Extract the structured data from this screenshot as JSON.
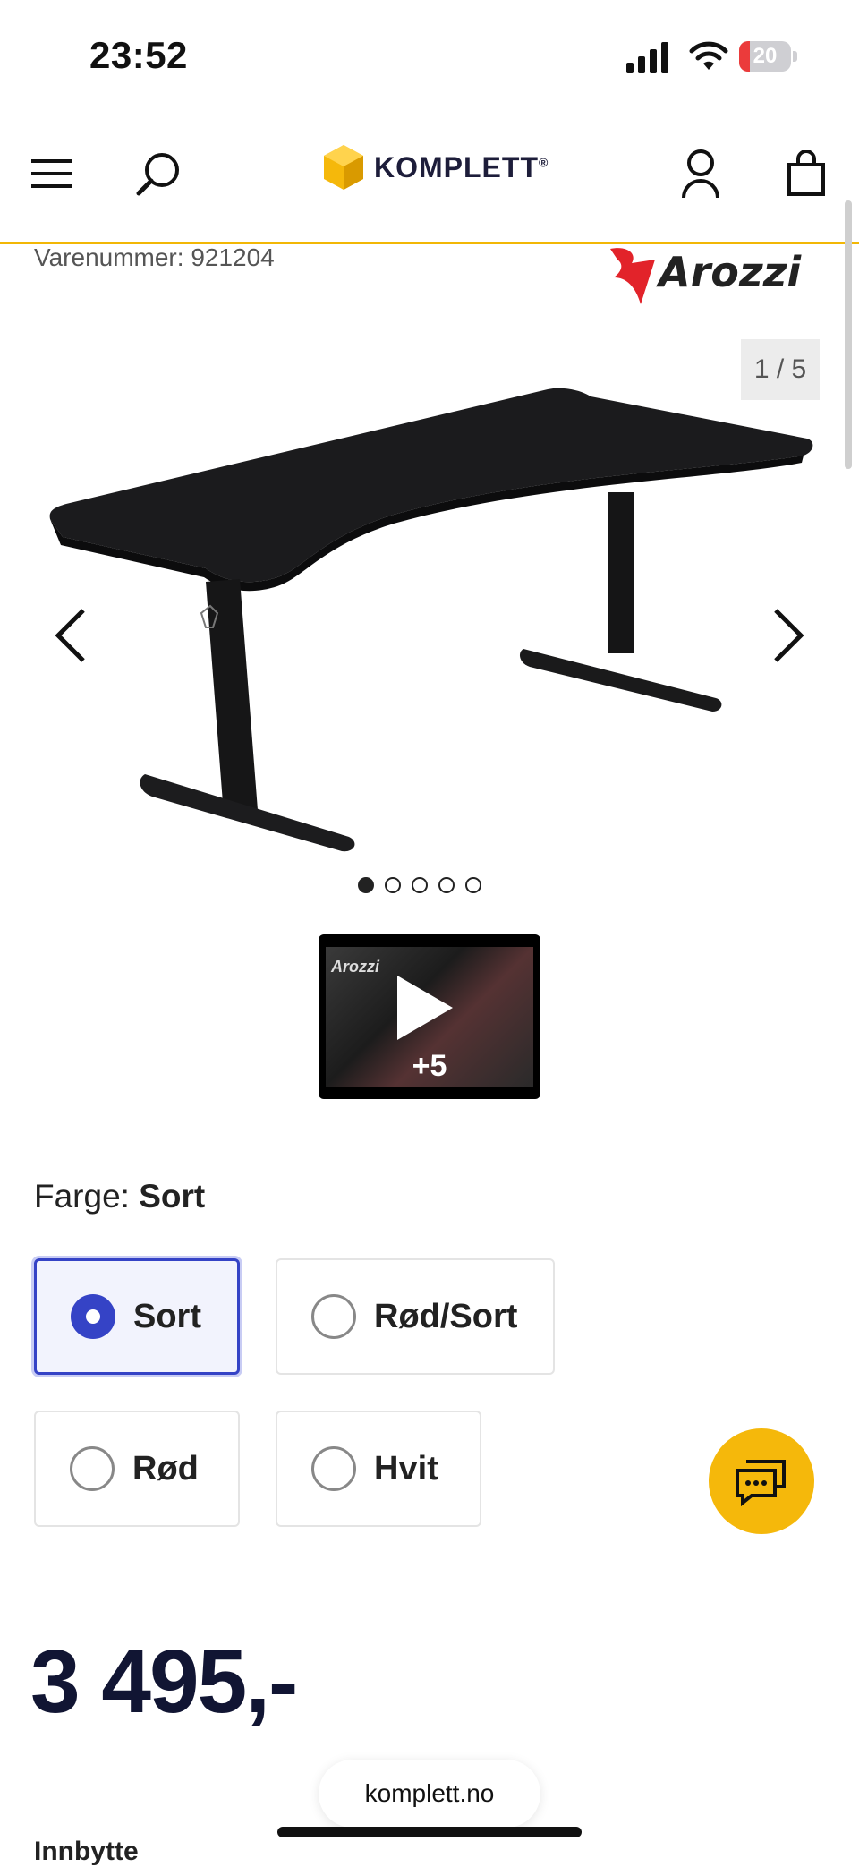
{
  "status_bar": {
    "time": "23:52",
    "battery_level": "20",
    "icons": [
      "signal-icon",
      "wifi-icon",
      "battery-icon"
    ]
  },
  "header": {
    "logo_text": "KOMPLETT",
    "logo_mark": "®",
    "icons": [
      "menu-icon",
      "search-icon",
      "user-icon",
      "cart-icon"
    ],
    "accent_color": "#f2b705"
  },
  "product": {
    "sku_label": "Varenummer: 921204",
    "brand": "Arozzi",
    "gallery": {
      "counter": "1 / 5",
      "image_count": 5,
      "active_index": 0
    },
    "video": {
      "more_label": "+5",
      "thumb_brand": "Arozzi"
    },
    "color": {
      "label": "Farge:",
      "selected": "Sort",
      "options": [
        {
          "label": "Sort",
          "selected": true
        },
        {
          "label": "Rød/Sort",
          "selected": false
        },
        {
          "label": "Rød",
          "selected": false
        },
        {
          "label": "Hvit",
          "selected": false
        }
      ]
    },
    "price": "3 495,-",
    "next_section": "Innbytte"
  },
  "browser": {
    "url": "komplett.no"
  },
  "colors": {
    "selected_border": "#3543c6",
    "chat_button": "#f5b80b",
    "price_text": "#111533"
  }
}
